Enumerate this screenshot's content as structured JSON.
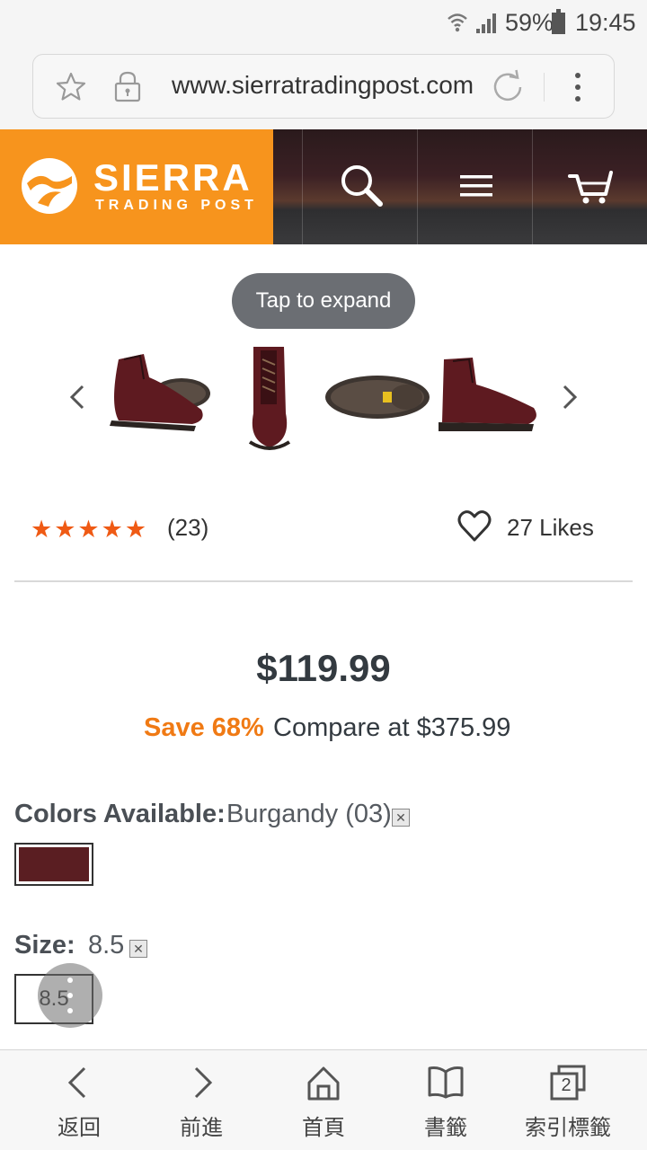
{
  "status_bar": {
    "battery_percent": "59%",
    "time": "19:45",
    "icons": [
      "wifi-icon",
      "signal-icon",
      "battery-icon"
    ]
  },
  "browser": {
    "url": "www.sierratradingpost.com",
    "icons": [
      "bookmark-star-icon",
      "lock-icon",
      "reload-icon",
      "more-menu-icon"
    ]
  },
  "site_header": {
    "logo_name": "SIERRA",
    "logo_sub": "TRADING POST",
    "brand_color": "#f7941d",
    "icons": [
      "search-icon",
      "hamburger-menu-icon",
      "cart-icon"
    ]
  },
  "gallery": {
    "tooltip": "Tap to expand",
    "thumbnails": [
      "boot-side-and-sole",
      "boot-front",
      "boot-sole",
      "boot-side"
    ]
  },
  "rating": {
    "stars": "★★★★★",
    "star_value": 5,
    "count": "(23)",
    "star_color": "#ef5a14"
  },
  "likes": {
    "label": "27 Likes"
  },
  "pricing": {
    "price": "$119.99",
    "savings": "Save 68%",
    "compare": "Compare at $375.99",
    "savings_color": "#f07a14"
  },
  "colors": {
    "label": "Colors Available:",
    "selected": "Burgandy (03)",
    "swatch_color": "#5a1e22"
  },
  "size": {
    "label": "Size:",
    "selected": "8.5",
    "options": [
      "8.5"
    ]
  },
  "bottom_nav": {
    "items": [
      {
        "label": "返回",
        "icon": "back-arrow-icon"
      },
      {
        "label": "前進",
        "icon": "forward-arrow-icon"
      },
      {
        "label": "首頁",
        "icon": "home-icon"
      },
      {
        "label": "書籤",
        "icon": "bookmarks-icon"
      },
      {
        "label": "索引標籤",
        "icon": "tabs-icon",
        "badge": "2"
      }
    ]
  }
}
